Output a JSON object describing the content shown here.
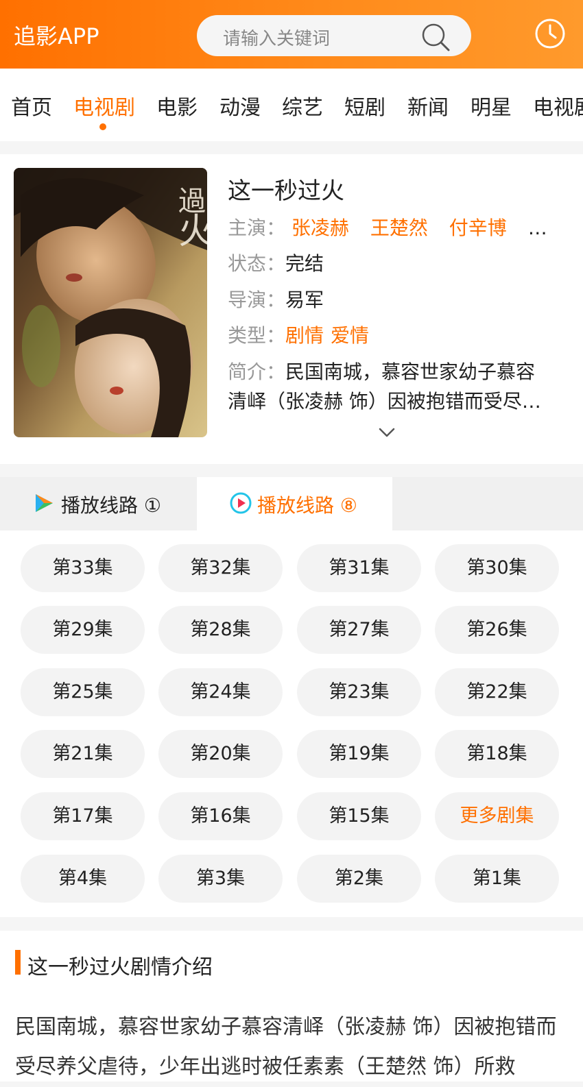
{
  "header": {
    "logo": "追影APP",
    "search_placeholder": "请输入关键词"
  },
  "nav": {
    "items": [
      "首页",
      "电视剧",
      "电影",
      "动漫",
      "综艺",
      "短剧",
      "新闻",
      "明星",
      "电视剧"
    ],
    "active_index": 1
  },
  "show": {
    "title": "这一秒过火",
    "cast_label": "主演：",
    "cast": [
      "张凌赫",
      "王楚然",
      "付辛博"
    ],
    "cast_more": "…",
    "status_label": "状态：",
    "status": "完结",
    "director_label": "导演：",
    "director": "易军",
    "genre_label": "类型：",
    "genres": [
      "剧情",
      "爱情"
    ],
    "synopsis_label": "简介：",
    "synopsis": "民国南城，慕容世家幼子慕容清峄（张凌赫 饰）因被抱错而受尽养父虐待，少年出逃时被任素素（王楚然 饰）所救"
  },
  "tabs": [
    {
      "label": "播放线路 ①"
    },
    {
      "label": "播放线路 ⑧"
    }
  ],
  "episodes": [
    "第33集",
    "第32集",
    "第31集",
    "第30集",
    "第29集",
    "第28集",
    "第27集",
    "第26集",
    "第25集",
    "第24集",
    "第23集",
    "第22集",
    "第21集",
    "第20集",
    "第19集",
    "第18集",
    "第17集",
    "第16集",
    "第15集",
    "更多剧集",
    "第4集",
    "第3集",
    "第2集",
    "第1集"
  ],
  "intro": {
    "title": "这一秒过火剧情介绍",
    "text": "民国南城，慕容世家幼子慕容清峄（张凌赫 饰）因被抱错而受尽养父虐待，少年出逃时被任素素（王楚然 饰）所救"
  },
  "colors": {
    "accent": "#ff7000",
    "header_gradient_start": "#ff7000",
    "header_gradient_end": "#ff9a2c"
  }
}
